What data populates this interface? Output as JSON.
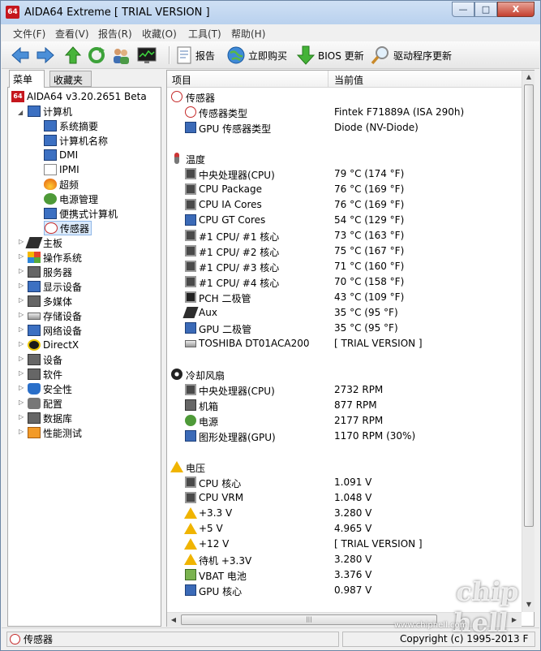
{
  "window": {
    "icon_text": "64",
    "title": "AIDA64 Extreme  [ TRIAL VERSION ]",
    "min_glyph": "—",
    "max_glyph": "□",
    "close_glyph": "X"
  },
  "menu": [
    "文件(F)",
    "查看(V)",
    "报告(R)",
    "收藏(O)",
    "工具(T)",
    "帮助(H)"
  ],
  "toolbar": {
    "report": "报告",
    "buy": "立即购买",
    "bios": "BIOS 更新",
    "driver": "驱动程序更新"
  },
  "tabs": {
    "menu": "菜单",
    "favorites": "收藏夹"
  },
  "tree": {
    "root": "AIDA64 v3.20.2651 Beta",
    "computer": "计算机",
    "computer_children": [
      "系统摘要",
      "计算机名称",
      "DMI",
      "IPMI",
      "超频",
      "电源管理",
      "便携式计算机",
      "传感器"
    ],
    "categories": [
      "主板",
      "操作系统",
      "服务器",
      "显示设备",
      "多媒体",
      "存储设备",
      "网络设备",
      "DirectX",
      "设备",
      "软件",
      "安全性",
      "配置",
      "数据库",
      "性能测试"
    ]
  },
  "columns": {
    "item": "项目",
    "value": "当前值"
  },
  "sections": {
    "sensor": {
      "title": "传感器",
      "rows": [
        {
          "label": "传感器类型",
          "value": "Fintek F71889A  (ISA 290h)"
        },
        {
          "label": "GPU 传感器类型",
          "value": "Diode  (NV-Diode)"
        }
      ]
    },
    "temperature": {
      "title": "温度",
      "rows": [
        {
          "label": "中央处理器(CPU)",
          "value": "79 °C  (174 °F)"
        },
        {
          "label": "CPU Package",
          "value": "76 °C  (169 °F)"
        },
        {
          "label": "CPU IA Cores",
          "value": "76 °C  (169 °F)"
        },
        {
          "label": "CPU GT Cores",
          "value": "54 °C  (129 °F)"
        },
        {
          "label": "#1 CPU/ #1 核心",
          "value": "73 °C  (163 °F)"
        },
        {
          "label": "#1 CPU/ #2 核心",
          "value": "75 °C  (167 °F)"
        },
        {
          "label": "#1 CPU/ #3 核心",
          "value": "71 °C  (160 °F)"
        },
        {
          "label": "#1 CPU/ #4 核心",
          "value": "70 °C  (158 °F)"
        },
        {
          "label": "PCH 二极管",
          "value": "43 °C  (109 °F)"
        },
        {
          "label": "Aux",
          "value": "35 °C  (95 °F)"
        },
        {
          "label": "GPU 二极管",
          "value": "35 °C  (95 °F)"
        },
        {
          "label": "TOSHIBA DT01ACA200",
          "value": "[ TRIAL VERSION ]"
        }
      ]
    },
    "fans": {
      "title": "冷却风扇",
      "rows": [
        {
          "label": "中央处理器(CPU)",
          "value": "2732 RPM"
        },
        {
          "label": "机箱",
          "value": "877 RPM"
        },
        {
          "label": "电源",
          "value": "2177 RPM"
        },
        {
          "label": "图形处理器(GPU)",
          "value": "1170 RPM  (30%)"
        }
      ]
    },
    "voltage": {
      "title": "电压",
      "rows": [
        {
          "label": "CPU 核心",
          "value": "1.091 V"
        },
        {
          "label": "CPU VRM",
          "value": "1.048 V"
        },
        {
          "label": "+3.3 V",
          "value": "3.280 V"
        },
        {
          "label": "+5 V",
          "value": "4.965 V"
        },
        {
          "label": "+12 V",
          "value": "[ TRIAL VERSION ]"
        },
        {
          "label": "待机 +3.3V",
          "value": "3.280 V"
        },
        {
          "label": "VBAT 电池",
          "value": "3.376 V"
        },
        {
          "label": "GPU 核心",
          "value": "0.987 V"
        }
      ]
    }
  },
  "status": {
    "left": "传感器",
    "right": "Copyright (c) 1995-2013 F"
  },
  "watermark": {
    "logo": "chip hell",
    "url": "www.chiphell.com"
  }
}
